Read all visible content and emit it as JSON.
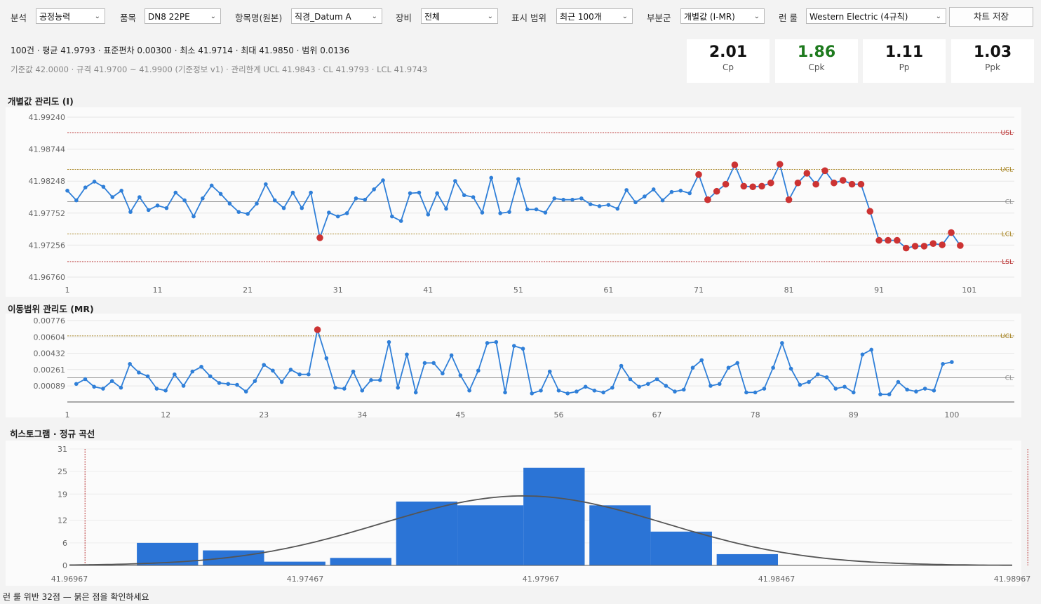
{
  "toolbar": {
    "controls": [
      {
        "label": "분석",
        "value": "공정능력"
      },
      {
        "label": "품목",
        "value": "DN8 22PE"
      },
      {
        "label": "항목명(원본)",
        "value": "직경_Datum A"
      },
      {
        "label": "장비",
        "value": "전체"
      },
      {
        "label": "표시 범위",
        "value": "최근 100개"
      },
      {
        "label": "부분군",
        "value": "개별값 (I-MR)"
      },
      {
        "label": "런 룰",
        "value": "Western Electric (4규칙)"
      }
    ],
    "save_label": "차트 저장"
  },
  "summary": {
    "line1": "100건 · 평균 41.9793 · 표준편차 0.00300 · 최소 41.9714 · 최대 41.9850 · 범위 0.0136",
    "line2": "기준값 42.0000 · 규격 41.9700 ~ 41.9900 (기준정보 v1)   ·   관리한계 UCL 41.9843 · CL 41.9793 · LCL 41.9743"
  },
  "capability": [
    {
      "label": "Cp",
      "value": "2.01",
      "color": "#111111"
    },
    {
      "label": "Cpk",
      "value": "1.86",
      "color": "#1e7a1e"
    },
    {
      "label": "Pp",
      "value": "1.11",
      "color": "#111111"
    },
    {
      "label": "Ppk",
      "value": "1.03",
      "color": "#111111"
    }
  ],
  "colors": {
    "line": "#2f7fd8",
    "point": "#2f7fd8",
    "violation": "#cc3333",
    "spec": "#b32020",
    "ctrl": "#a07a10",
    "cl": "#888888",
    "bar": "#2b74d6",
    "curve": "#555555"
  },
  "chart_data": [
    {
      "type": "line",
      "title": "개별값 관리도 (I)",
      "ylim": [
        41.9676,
        41.9924
      ],
      "yticks": [
        "41.99240",
        "41.98744",
        "41.98248",
        "41.97752",
        "41.97256",
        "41.96760"
      ],
      "ytick_values": [
        41.9924,
        41.98744,
        41.98248,
        41.97752,
        41.97256,
        41.9676
      ],
      "xticks": [
        "1",
        "11",
        "21",
        "31",
        "41",
        "51",
        "61",
        "71",
        "81",
        "91",
        "101"
      ],
      "xlim": [
        1,
        106
      ],
      "lines": [
        {
          "name": "USL",
          "value": 41.99
        },
        {
          "name": "UCL",
          "value": 41.9843
        },
        {
          "name": "CL",
          "value": 41.9793
        },
        {
          "name": "LCL",
          "value": 41.9743
        },
        {
          "name": "LSL",
          "value": 41.97
        }
      ],
      "x_start": 1,
      "values": [
        41.981,
        41.9795,
        41.9815,
        41.9824,
        41.9816,
        41.98,
        41.981,
        41.9777,
        41.98,
        41.978,
        41.9787,
        41.9783,
        41.9807,
        41.9795,
        41.977,
        41.9798,
        41.9818,
        41.9805,
        41.979,
        41.9777,
        41.9774,
        41.979,
        41.982,
        41.9795,
        41.9783,
        41.9807,
        41.9783,
        41.9807,
        41.9737,
        41.9776,
        41.977,
        41.9775,
        41.9798,
        41.9796,
        41.9812,
        41.9826,
        41.977,
        41.9763,
        41.9806,
        41.9807,
        41.9773,
        41.9806,
        41.9782,
        41.9825,
        41.9803,
        41.98,
        41.9776,
        41.983,
        41.9775,
        41.9777,
        41.9828,
        41.9781,
        41.9781,
        41.9776,
        41.9798,
        41.9796,
        41.9796,
        41.9798,
        41.9789,
        41.9786,
        41.9788,
        41.9782,
        41.9811,
        41.9792,
        41.9801,
        41.9812,
        41.9795,
        41.9808,
        41.981,
        41.9806,
        41.9835,
        41.9796,
        41.9809,
        41.982,
        41.985,
        41.9817,
        41.9816,
        41.9817,
        41.9822,
        41.9851,
        41.9796,
        41.9822,
        41.9837,
        41.982,
        41.9841,
        41.9822,
        41.9826,
        41.982,
        41.982,
        41.9778,
        41.9733,
        41.9733,
        41.9733,
        41.9721,
        41.9724,
        41.9724,
        41.9728,
        41.9726,
        41.9745,
        41.9725
      ],
      "violations": [
        29,
        71,
        72,
        73,
        74,
        75,
        76,
        77,
        78,
        79,
        80,
        81,
        82,
        83,
        84,
        85,
        86,
        87,
        88,
        89,
        90,
        91,
        92,
        93,
        94,
        95,
        96,
        97,
        98,
        99,
        100,
        101
      ]
    },
    {
      "type": "line",
      "title": "이동범위 관리도 (MR)",
      "ylim": [
        -0.0008,
        0.00776
      ],
      "yticks": [
        "0.00776",
        "0.00604",
        "0.00432",
        "0.00261",
        "0.00089"
      ],
      "ytick_values": [
        0.00776,
        0.00604,
        0.00432,
        0.00261,
        0.00089
      ],
      "xticks": [
        "1",
        "12",
        "23",
        "34",
        "45",
        "56",
        "67",
        "78",
        "89",
        "100"
      ],
      "xlim": [
        1,
        107
      ],
      "lines": [
        {
          "name": "UCL",
          "value": 0.00615
        },
        {
          "name": "CL",
          "value": 0.00175
        }
      ],
      "x_start": 2,
      "values": [
        0.0011,
        0.0016,
        0.0008,
        0.0006,
        0.0014,
        0.0007,
        0.0032,
        0.0023,
        0.0019,
        0.0006,
        0.0004,
        0.0021,
        0.0009,
        0.0024,
        0.0029,
        0.0019,
        0.0012,
        0.0011,
        0.001,
        0.0003,
        0.0014,
        0.0031,
        0.0025,
        0.0013,
        0.0026,
        0.0021,
        0.0021,
        0.0068,
        0.0038,
        0.0007,
        0.0006,
        0.0024,
        0.0004,
        0.0015,
        0.0015,
        0.0055,
        0.0007,
        0.0042,
        0.0002,
        0.0033,
        0.0033,
        0.0022,
        0.0041,
        0.002,
        0.0004,
        0.0025,
        0.0054,
        0.0055,
        0.0002,
        0.0051,
        0.0048,
        0.0001,
        0.0004,
        0.0024,
        0.0004,
        0.0001,
        0.0003,
        0.0008,
        0.0004,
        0.0002,
        0.0007,
        0.003,
        0.0016,
        0.0008,
        0.0011,
        0.0016,
        0.0009,
        0.0003,
        0.0005,
        0.0028,
        0.0036,
        0.0009,
        0.0011,
        0.0028,
        0.0033,
        0.0002,
        0.0002,
        0.0006,
        0.0028,
        0.0054,
        0.0027,
        0.001,
        0.0013,
        0.0021,
        0.0018,
        0.0006,
        0.0008,
        0.0002,
        0.0042,
        0.0047,
        0.0,
        0.0,
        0.0013,
        0.0005,
        0.0003,
        0.0006,
        0.0004,
        0.0032,
        0.0034
      ],
      "violations": [
        29
      ]
    },
    {
      "type": "bar",
      "title": "히스토그램 · 정규 곡선",
      "xlim": [
        41.96967,
        41.98967
      ],
      "xticks": [
        "41.96967",
        "41.97467",
        "41.97967",
        "41.98467",
        "41.98967"
      ],
      "xtick_values": [
        41.96967,
        41.97467,
        41.97967,
        41.98467,
        41.98967
      ],
      "ylim": [
        0,
        31
      ],
      "yticks": [
        "31",
        "25",
        "19",
        "12",
        "6",
        "0"
      ],
      "ytick_values": [
        31,
        25,
        19,
        12,
        6,
        0
      ],
      "bins": [
        {
          "from": 41.9711,
          "to": 41.9724,
          "count": 6
        },
        {
          "from": 41.9725,
          "to": 41.9738,
          "count": 4
        },
        {
          "from": 41.9738,
          "to": 41.9751,
          "count": 1
        },
        {
          "from": 41.9752,
          "to": 41.9765,
          "count": 2
        },
        {
          "from": 41.9766,
          "to": 41.9779,
          "count": 17
        },
        {
          "from": 41.9779,
          "to": 41.9793,
          "count": 16
        },
        {
          "from": 41.9793,
          "to": 41.9806,
          "count": 26
        },
        {
          "from": 41.9807,
          "to": 41.982,
          "count": 16
        },
        {
          "from": 41.982,
          "to": 41.9833,
          "count": 9
        },
        {
          "from": 41.9834,
          "to": 41.9847,
          "count": 3
        }
      ],
      "spec_lines": [
        41.97,
        41.99
      ],
      "normal": {
        "mean": 41.9793,
        "sd": 0.003,
        "peak": 18.5
      }
    }
  ],
  "status": "런 룰 위반 32점 — 붉은 점을 확인하세요"
}
